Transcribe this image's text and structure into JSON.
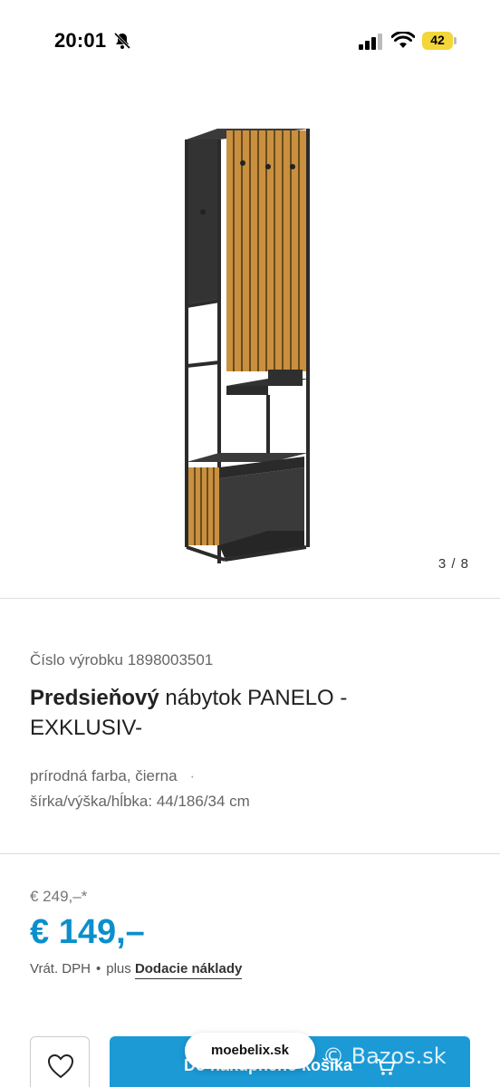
{
  "status_bar": {
    "time": "20:01",
    "battery": "42"
  },
  "gallery": {
    "counter": "3 / 8"
  },
  "product": {
    "number_label": "Číslo výrobku",
    "number": "1898003501",
    "title_bold": "Predsieňový",
    "title_rest": "nábytok PANELO - EXKLUSIV-",
    "color": "prírodná farba, čierna",
    "separator": "·",
    "dimensions": "šírka/výška/hĺbka: 44/186/34 cm"
  },
  "pricing": {
    "old_price": "€ 249,–*",
    "price": "€ 149,–",
    "tax": "Vrát. DPH",
    "bullet": "•",
    "plus": "plus",
    "shipping_link": "Dodacie náklady"
  },
  "actions": {
    "cart_label": "Do nákupného košíka"
  },
  "browser": {
    "url": "moebelix.sk"
  },
  "watermark": "© Bazos.sk",
  "colors": {
    "accent": "#1b9ad6",
    "price": "#0b8fcc",
    "battery": "#f2d63a"
  }
}
